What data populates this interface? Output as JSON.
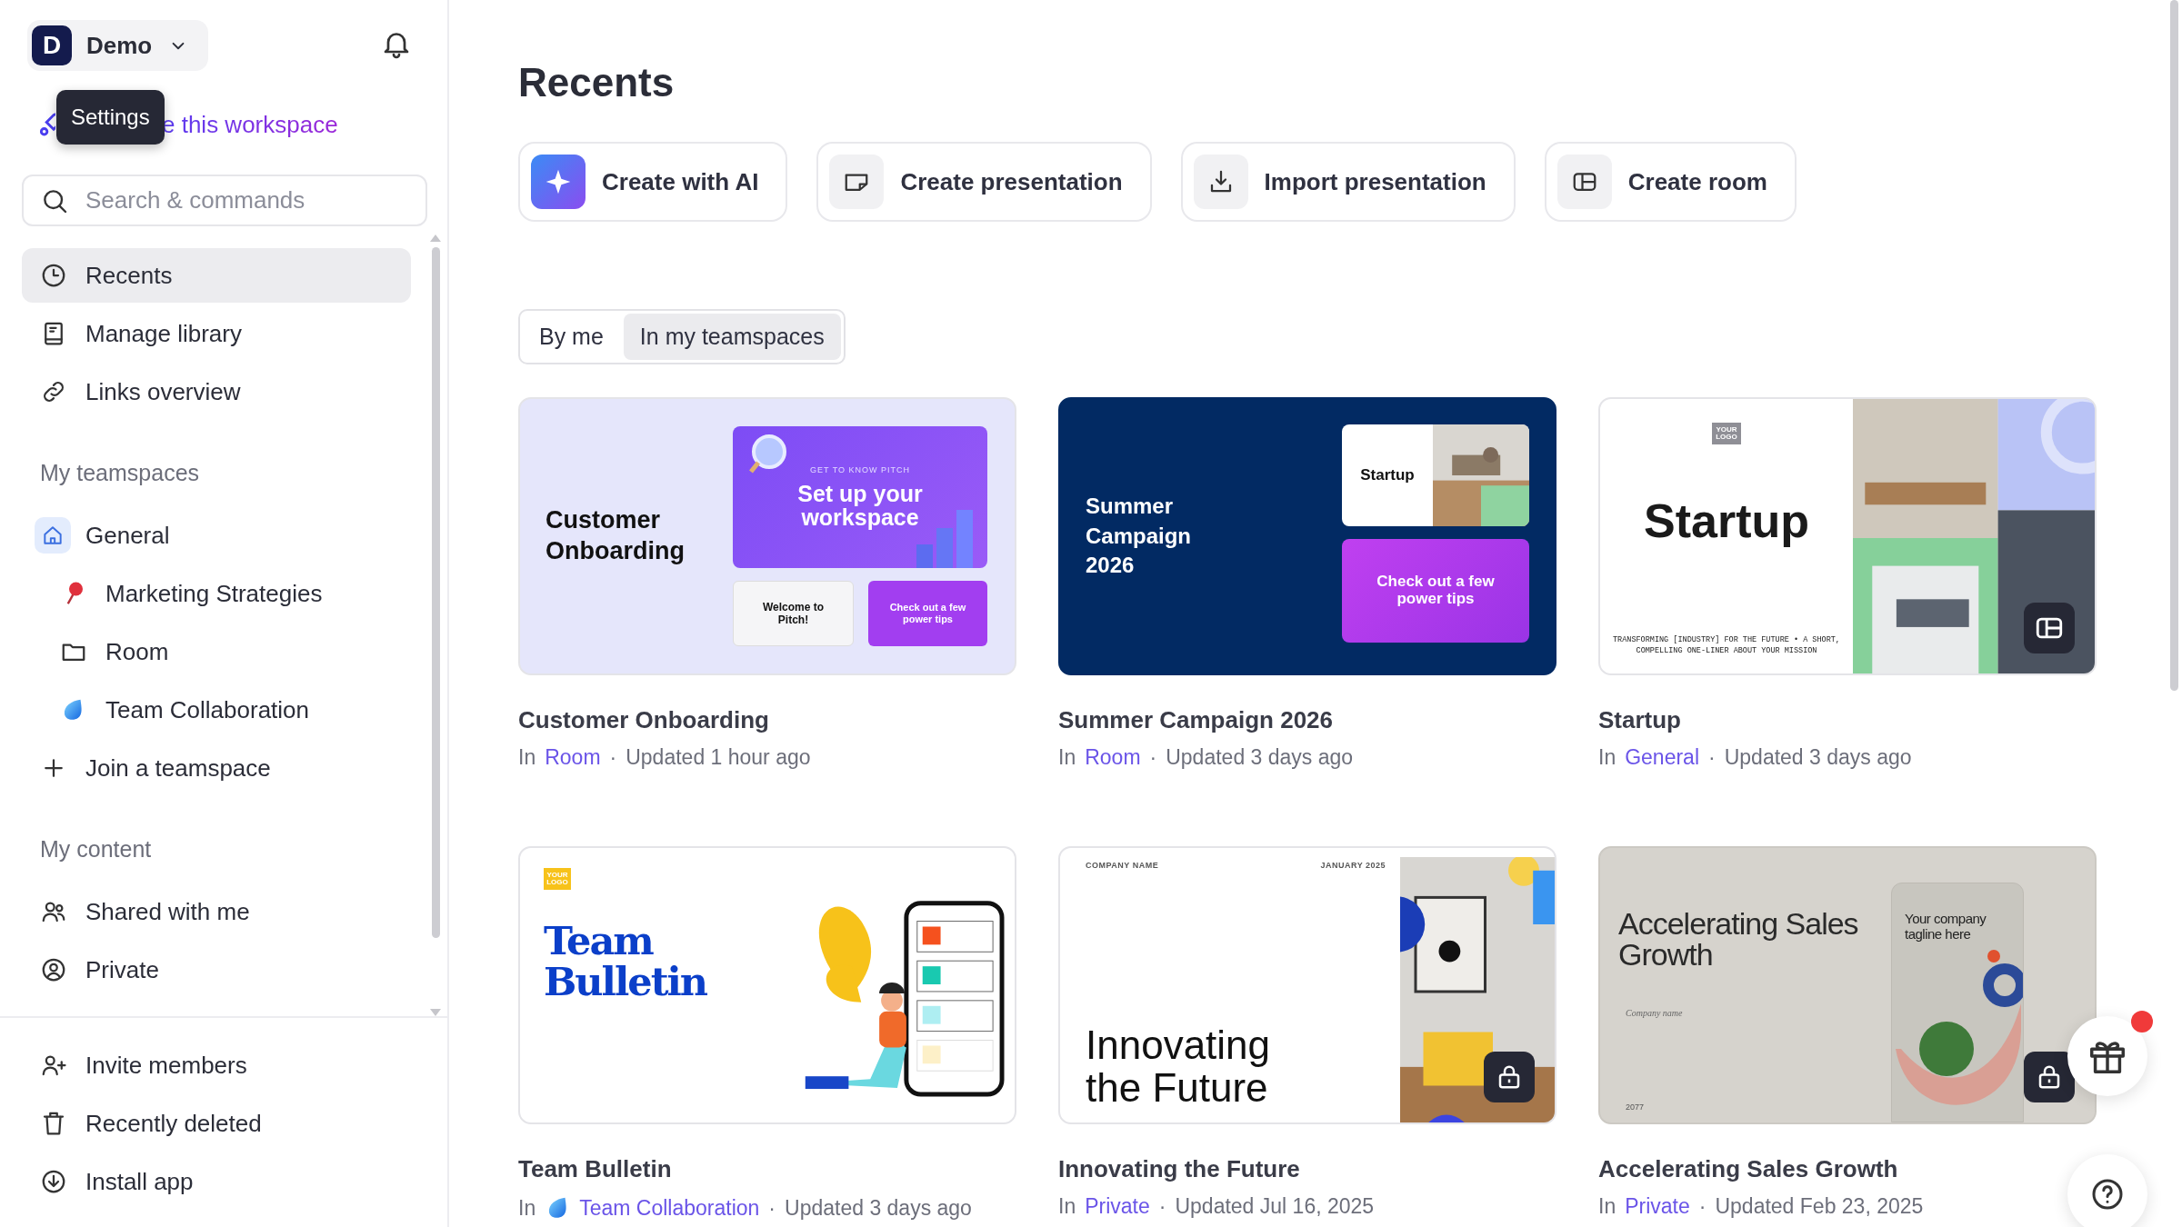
{
  "sidebar": {
    "workspace": {
      "initial": "D",
      "name": "Demo"
    },
    "tooltip": "Settings",
    "workspace_link": "e this workspace",
    "search": {
      "placeholder": "Search & commands"
    },
    "nav": [
      {
        "kind": "clock",
        "label": "Recents",
        "selected": true
      },
      {
        "kind": "book",
        "label": "Manage library",
        "selected": false
      },
      {
        "kind": "link",
        "label": "Links overview",
        "selected": false
      }
    ],
    "sections": [
      {
        "heading": "My teamspaces",
        "items": [
          {
            "kind": "house",
            "label": "General",
            "selected": false,
            "children": [
              {
                "kind": "pin",
                "label": "Marketing Strategies",
                "selected": false
              },
              {
                "kind": "folder",
                "label": "Room",
                "selected": false
              },
              {
                "kind": "blob",
                "label": "Team Collaboration",
                "selected": false
              }
            ]
          },
          {
            "kind": "plus",
            "label": "Join a teamspace",
            "selected": false
          }
        ]
      },
      {
        "heading": "My content",
        "items": [
          {
            "kind": "people",
            "label": "Shared with me",
            "selected": false
          },
          {
            "kind": "person",
            "label": "Private",
            "selected": false
          }
        ]
      }
    ],
    "footer": [
      {
        "kind": "add-person",
        "label": "Invite members",
        "selected": false
      },
      {
        "kind": "trash",
        "label": "Recently deleted",
        "selected": false
      },
      {
        "kind": "download",
        "label": "Install app",
        "selected": false
      }
    ]
  },
  "main": {
    "title": "Recents",
    "actions": [
      {
        "kind": "ai",
        "label": "Create with AI"
      },
      {
        "kind": "presentation",
        "label": "Create presentation"
      },
      {
        "kind": "import",
        "label": "Import presentation"
      },
      {
        "kind": "room",
        "label": "Create room"
      }
    ],
    "filters": [
      {
        "label": "By me",
        "selected": false
      },
      {
        "label": "In my teamspaces",
        "selected": true
      }
    ],
    "cards": [
      {
        "title": "Customer Onboarding",
        "prefix": "In",
        "location": "Room",
        "separator": "·",
        "updated": "Updated 1 hour ago",
        "thumbnail": {
          "kind": "onboarding",
          "title": "Customer Onboarding",
          "eyebrow": "GET TO KNOW PITCH",
          "headline": "Set up your workspace",
          "welcome": "Welcome to Pitch!",
          "tips": "Check out a few power tips"
        }
      },
      {
        "title": "Summer Campaign 2026",
        "prefix": "In",
        "location": "Room",
        "separator": "·",
        "updated": "Updated 3 days ago",
        "thumbnail": {
          "kind": "campaign",
          "title": "Summer Campaign 2026",
          "slide_title": "Startup",
          "tips": "Check out a few power tips"
        }
      },
      {
        "title": "Startup",
        "prefix": "In",
        "location": "General",
        "separator": "·",
        "updated": "Updated 3 days ago",
        "badge": {
          "kind": "room"
        },
        "thumbnail": {
          "kind": "startup",
          "logo": "YOUR LOGO",
          "title": "Startup",
          "tagline": "TRANSFORMING [INDUSTRY] FOR THE FUTURE • A SHORT, COMPELLING ONE-LINER ABOUT YOUR MISSION"
        }
      },
      {
        "title": "Team Bulletin",
        "prefix": "In",
        "location": "Team Collaboration",
        "location_icon": {
          "kind": "blob"
        },
        "separator": "·",
        "updated": "Updated 3 days ago",
        "thumbnail": {
          "kind": "bulletin",
          "logo": "YOUR LOGO",
          "title": "Team Bulletin"
        }
      },
      {
        "title": "Innovating the Future",
        "prefix": "In",
        "location": "Private",
        "separator": "·",
        "updated": "Updated Jul 16, 2025",
        "badge": {
          "kind": "lock"
        },
        "thumbnail": {
          "kind": "innovating",
          "company": "COMPANY NAME",
          "date": "JANUARY 2025",
          "title": "Innovating the Future"
        }
      },
      {
        "title": "Accelerating Sales Growth",
        "prefix": "In",
        "location": "Private",
        "separator": "·",
        "updated": "Updated Feb 23, 2025",
        "badge": {
          "kind": "lock"
        },
        "thumbnail": {
          "kind": "sales",
          "title": "Accelerating Sales Growth",
          "company": "Company name",
          "year": "2077",
          "tagline": "Your company tagline here"
        }
      }
    ]
  },
  "floating": [
    {
      "kind": "gift",
      "notification": true
    },
    {
      "kind": "help",
      "notification": false
    }
  ]
}
